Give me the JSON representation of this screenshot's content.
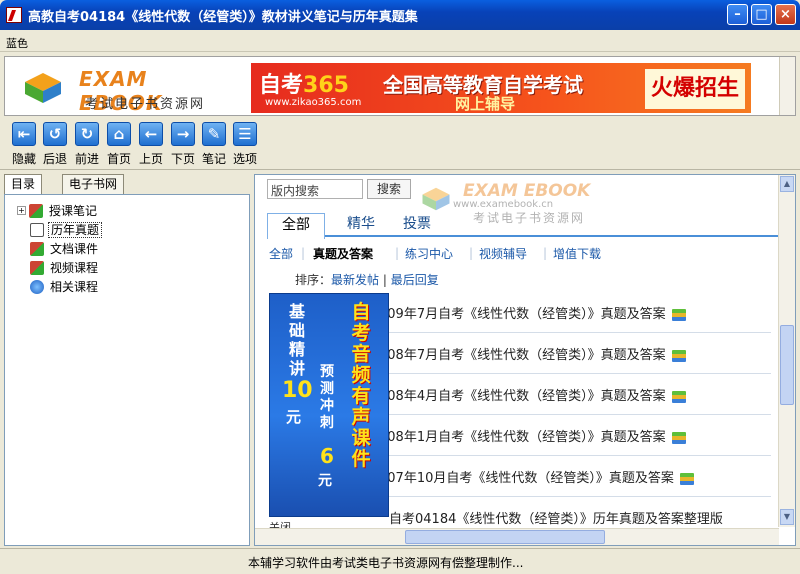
{
  "window": {
    "title": "高教自考04184《线性代数（经管类）》教材讲义笔记与历年真题集"
  },
  "menu": {
    "item": "蓝色"
  },
  "banner": {
    "logo_brand": "EXAM EBOOK",
    "logo_sub": "考试电子书资源网",
    "ad_site_a": "自考",
    "ad_site_b": "365",
    "ad_url": "www.zikao365.com",
    "ad_headline": "全国高等教育自学考试",
    "ad_sub": "网上辅导",
    "ad_hot": "火爆招生"
  },
  "toolbar": [
    {
      "label": "隐藏",
      "icon": "hide-icon",
      "glyph": "⇤"
    },
    {
      "label": "后退",
      "icon": "back-icon",
      "glyph": "↺"
    },
    {
      "label": "前进",
      "icon": "forward-icon",
      "glyph": "↻"
    },
    {
      "label": "首页",
      "icon": "home-icon",
      "glyph": "⌂"
    },
    {
      "label": "上页",
      "icon": "prev-page-icon",
      "glyph": "←"
    },
    {
      "label": "下页",
      "icon": "next-page-icon",
      "glyph": "→"
    },
    {
      "label": "笔记",
      "icon": "notes-icon",
      "glyph": "✎"
    },
    {
      "label": "选项",
      "icon": "options-icon",
      "glyph": "☰"
    }
  ],
  "left_tabs": [
    "目录",
    "电子书网"
  ],
  "tree": [
    {
      "label": "授课笔记",
      "expandable": true
    },
    {
      "label": "历年真题",
      "selected": true
    },
    {
      "label": "文档课件"
    },
    {
      "label": "视频课程"
    },
    {
      "label": "相关课程"
    }
  ],
  "content": {
    "search_placeholder": "版内搜索",
    "search_button": "搜索",
    "watermark_brand": "EXAM EBOOK",
    "watermark_url": "www.examebook.cn",
    "watermark_sub": "考试电子书资源网",
    "tabs": [
      "全部",
      "精华",
      "投票"
    ],
    "subnav": [
      "全部",
      "真题及答案",
      "练习中心",
      "视频辅导",
      "增值下载"
    ],
    "sort_label": "排序：",
    "sort_newest": "最新发帖",
    "sort_last_reply": "最后回复",
    "rows": [
      "009年7月自考《线性代数（经管类）》真题及答案",
      "008年7月自考《线性代数（经管类）》真题及答案",
      "008年4月自考《线性代数（经管类）》真题及答案",
      "008年1月自考《线性代数（经管类）》真题及答案",
      "007年10月自考《线性代数（经管类）》真题及答案",
      "自考04184《线性代数（经管类）》历年真题及答案整理版"
    ],
    "ad": {
      "col1": "基础精讲",
      "price1": "10",
      "yuan": "元",
      "col2": "自考音频有声课件",
      "col3": "预测冲刺",
      "price2": "6"
    },
    "close_ad": "关闭"
  },
  "status": {
    "text": "本辅学习软件由考试类电子书资源网有偿整理制作..."
  }
}
